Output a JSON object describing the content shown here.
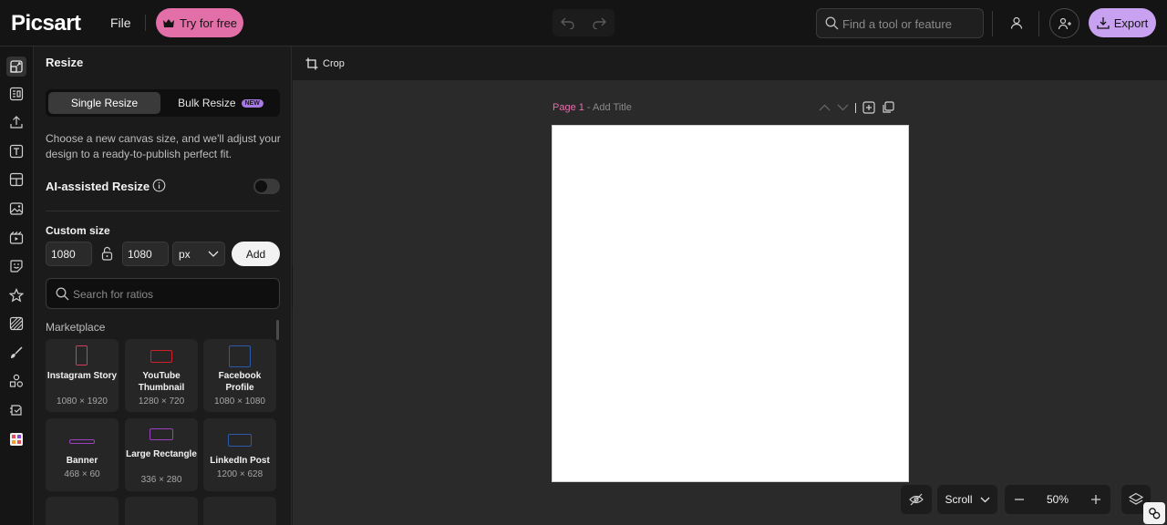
{
  "header": {
    "logo": "Picsart",
    "file_label": "File",
    "try_label": "Try for free",
    "search_placeholder": "Find a tool or feature",
    "export_label": "Export"
  },
  "rail": {
    "icons": [
      "design-icon",
      "templates-icon",
      "upload-icon",
      "text-icon",
      "layout-icon",
      "photos-icon",
      "video-icon",
      "stickers-icon",
      "favorites-icon",
      "backgrounds-icon",
      "brush-icon",
      "elements-icon",
      "ai-tools-icon",
      "resize-app-icon"
    ]
  },
  "panel": {
    "title": "Resize",
    "tab_single": "Single Resize",
    "tab_bulk": "Bulk Resize",
    "new_badge": "NEW",
    "description": "Choose a new canvas size, and we'll adjust your design to a ready-to-publish perfect fit.",
    "ai_label": "AI-assisted Resize",
    "ai_enabled": false,
    "custom_label": "Custom size",
    "width": "1080",
    "height": "1080",
    "unit": "px",
    "add_label": "Add",
    "ratio_placeholder": "Search for ratios",
    "section": "Marketplace",
    "cards": [
      {
        "name": "Instagram Story",
        "size": "1080 × 1920"
      },
      {
        "name": "YouTube Thumbnail",
        "size": "1280 × 720"
      },
      {
        "name": "Facebook Profile",
        "size": "1080 × 1080"
      },
      {
        "name": "Banner",
        "size": "468 × 60"
      },
      {
        "name": "Large Rectangle",
        "size": "336 × 280"
      },
      {
        "name": "LinkedIn Post",
        "size": "1200 × 628"
      }
    ]
  },
  "toolbar": {
    "crop_label": "Crop"
  },
  "canvas": {
    "page_label": "Page 1",
    "page_sep": " - ",
    "title_placeholder": "Add Title"
  },
  "bottom": {
    "view_mode": "Scroll",
    "zoom": "50%"
  },
  "colors": {
    "accent_pink": "#e26fa8",
    "accent_purple": "#c8a1f0",
    "bg_dark": "#141414",
    "canvas_bg": "#2a2a2a"
  }
}
